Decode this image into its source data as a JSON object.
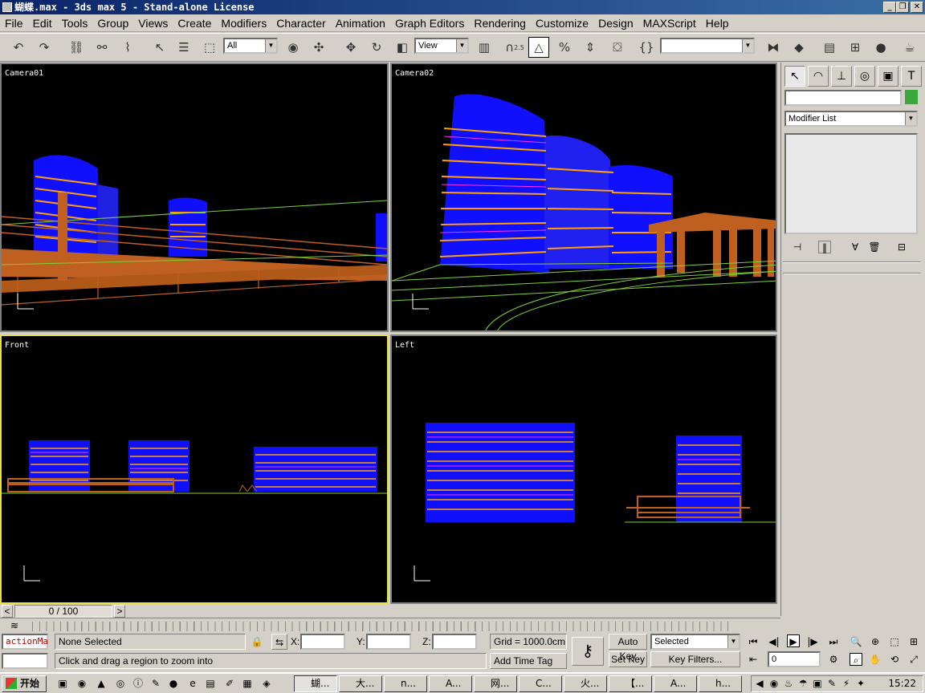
{
  "window": {
    "title": "蝴蝶.max - 3ds max 5 - Stand-alone License"
  },
  "menu": [
    "File",
    "Edit",
    "Tools",
    "Group",
    "Views",
    "Create",
    "Modifiers",
    "Character",
    "Animation",
    "Graph Editors",
    "Rendering",
    "Customize",
    "Design",
    "MAXScript",
    "Help"
  ],
  "toolbar": {
    "selection_filter": "All",
    "ref_coord": "View",
    "snap_label": "2.5",
    "named_sel": ""
  },
  "viewports": {
    "top_left": "Camera01",
    "top_right": "Camera02",
    "bottom_left": "Front",
    "bottom_right": "Left"
  },
  "command_panel": {
    "modifier_list": "Modifier List",
    "object_name": "",
    "object_color": "#3aa83a"
  },
  "timeline": {
    "frame": "0 / 100"
  },
  "status": {
    "selection": "None Selected",
    "prompt": "Click and drag a region to zoom into",
    "x_label": "X:",
    "y_label": "Y:",
    "z_label": "Z:",
    "grid": "Grid = 1000.0cm",
    "add_time_tag": "Add Time Tag",
    "auto_key": "Auto Key",
    "set_key": "Set Key",
    "key_mode": "Selected",
    "key_filters": "Key Filters...",
    "frame_field": "0",
    "maxscript_listener": "actionMa"
  },
  "taskbar": {
    "start": "开始",
    "tasks": [
      "蝴...",
      "大...",
      "n...",
      "A...",
      "网...",
      "C...",
      "火...",
      "【...",
      "A...",
      "h..."
    ],
    "clock": "15:22"
  },
  "colors": {
    "wire_building": "#1010ff",
    "wire_bridge": "#c06020",
    "wire_ground": "#80d030",
    "active_border": "#e8e040"
  }
}
